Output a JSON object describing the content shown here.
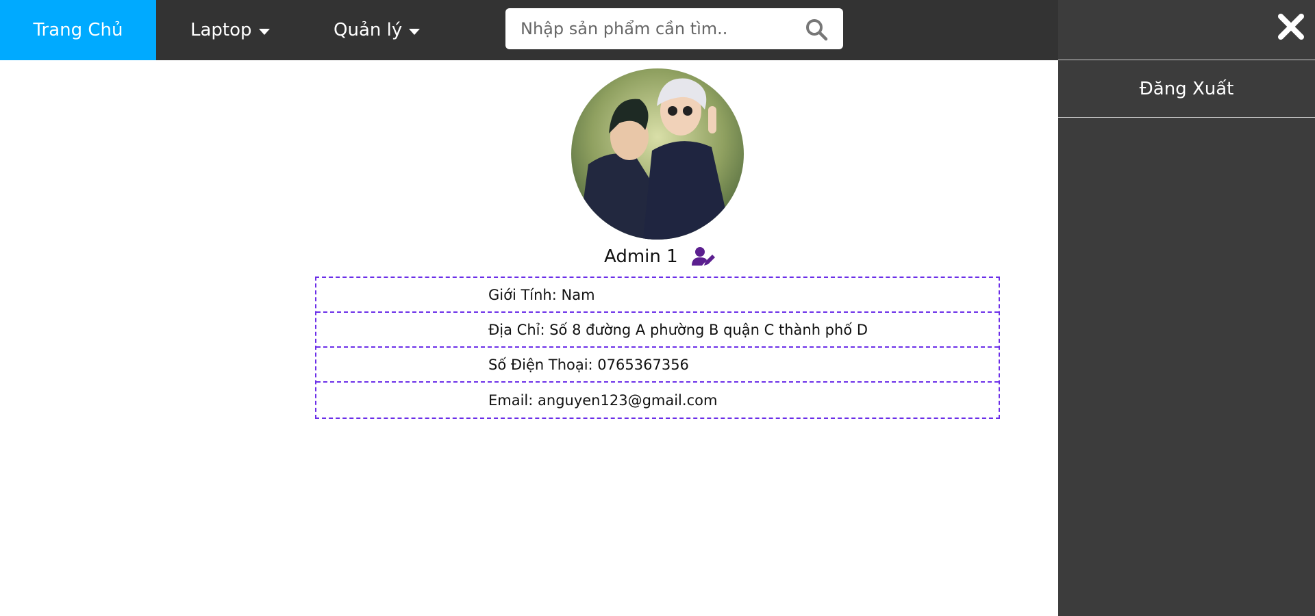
{
  "nav": {
    "home_label": "Trang Chủ",
    "laptop_label": "Laptop",
    "manage_label": "Quản lý"
  },
  "search": {
    "placeholder": "Nhập sản phẩm cần tìm..",
    "value": ""
  },
  "sidebar": {
    "logout_label": "Đăng Xuất"
  },
  "profile": {
    "name": "Admin 1",
    "gender": "Giới Tính: Nam",
    "address": "Địa Chỉ: Số 8 đường A phường B quận C thành phố D",
    "phone": "Số Điện Thoại: 0765367356",
    "email": "Email: anguyen123@gmail.com"
  },
  "colors": {
    "topbar": "#333333",
    "active_nav": "#00aaff",
    "sidebar": "#3c3c3c",
    "border_accent": "#6b2ee8",
    "edit_icon": "#5b1f8f"
  },
  "icons": {
    "search": "search-icon",
    "close": "close-icon",
    "edit_profile": "user-edit-icon",
    "caret": "caret-down-icon"
  }
}
